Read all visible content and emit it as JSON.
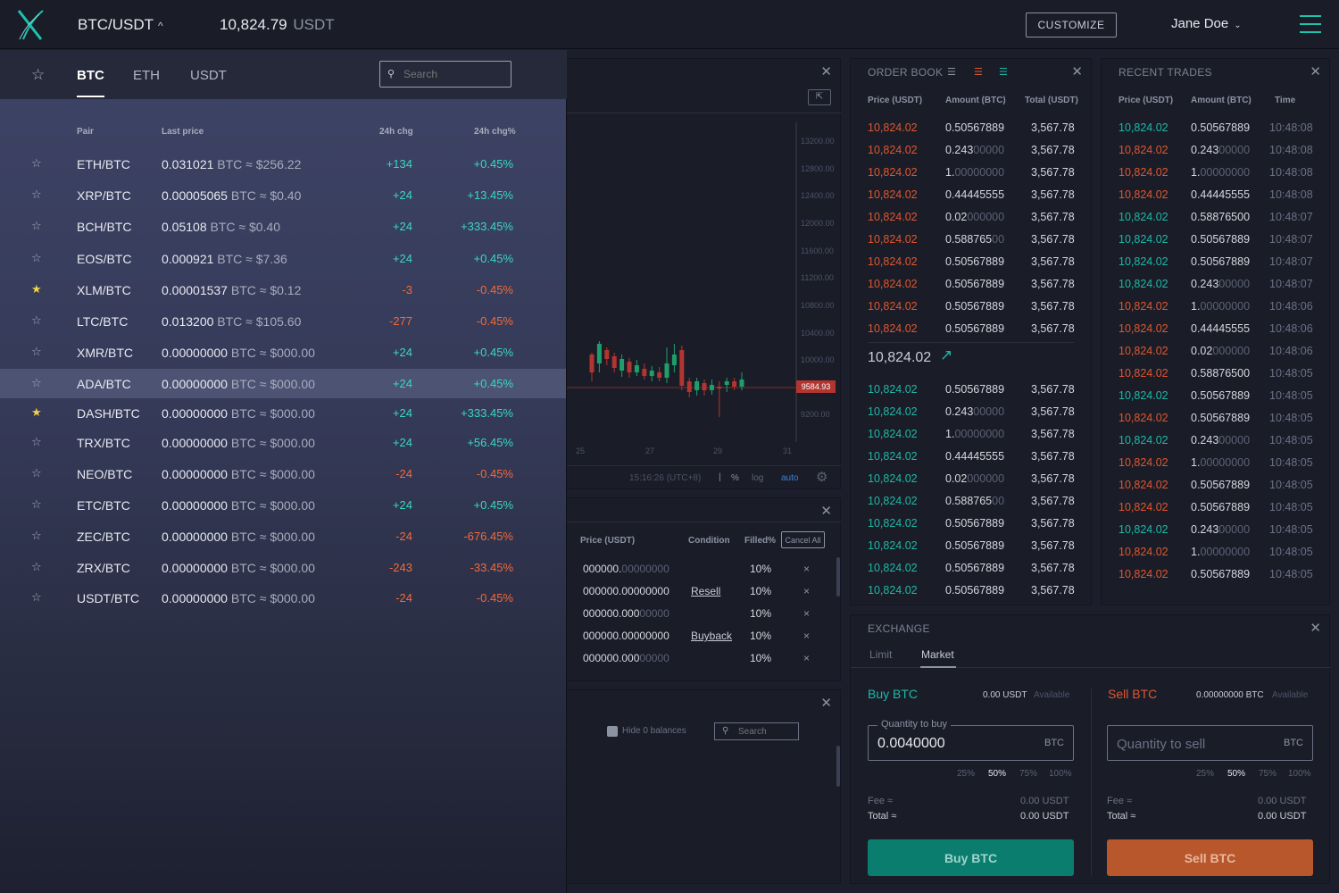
{
  "topbar": {
    "pair": "BTC/USDT",
    "price": "10,824.79",
    "price_unit": "USDT",
    "customize_label": "CUSTOMIZE",
    "user_name": "Jane Doe"
  },
  "market": {
    "tabs": [
      "BTC",
      "ETH",
      "USDT"
    ],
    "active_tab": "BTC",
    "search_placeholder": "Search",
    "headers": {
      "pair": "Pair",
      "last_price": "Last price",
      "chg": "24h chg",
      "chg_pct": "24h chg%"
    },
    "rows": [
      {
        "pair": "ETH/BTC",
        "price": "0.031021",
        "approx": "BTC ≈ $256.22",
        "chg": "+134",
        "pct": "+0.45%",
        "fav": false
      },
      {
        "pair": "XRP/BTC",
        "price": "0.00005065",
        "approx": "BTC ≈ $0.40",
        "chg": "+24",
        "pct": "+13.45%",
        "fav": false
      },
      {
        "pair": "BCH/BTC",
        "price": "0.05108",
        "approx": "BTC ≈ $0.40",
        "chg": "+24",
        "pct": "+333.45%",
        "fav": false
      },
      {
        "pair": "EOS/BTC",
        "price": "0.000921",
        "approx": "BTC ≈ $7.36",
        "chg": "+24",
        "pct": "+0.45%",
        "fav": false
      },
      {
        "pair": "XLM/BTC",
        "price": "0.00001537",
        "approx": "BTC ≈ $0.12",
        "chg": "-3",
        "pct": "-0.45%",
        "fav": true
      },
      {
        "pair": "LTC/BTC",
        "price": "0.013200",
        "approx": "BTC ≈ $105.60",
        "chg": "-277",
        "pct": "-0.45%",
        "fav": false
      },
      {
        "pair": "XMR/BTC",
        "price": "0.00000000",
        "approx": "BTC ≈ $000.00",
        "chg": "+24",
        "pct": "+0.45%",
        "fav": false
      },
      {
        "pair": "ADA/BTC",
        "price": "0.00000000",
        "approx": "BTC ≈ $000.00",
        "chg": "+24",
        "pct": "+0.45%",
        "fav": false,
        "selected": true
      },
      {
        "pair": "DASH/BTC",
        "price": "0.00000000",
        "approx": "BTC ≈ $000.00",
        "chg": "+24",
        "pct": "+333.45%",
        "fav": true
      },
      {
        "pair": "TRX/BTC",
        "price": "0.00000000",
        "approx": "BTC ≈ $000.00",
        "chg": "+24",
        "pct": "+56.45%",
        "fav": false
      },
      {
        "pair": "NEO/BTC",
        "price": "0.00000000",
        "approx": "BTC ≈ $000.00",
        "chg": "-24",
        "pct": "-0.45%",
        "fav": false
      },
      {
        "pair": "ETC/BTC",
        "price": "0.00000000",
        "approx": "BTC ≈ $000.00",
        "chg": "+24",
        "pct": "+0.45%",
        "fav": false
      },
      {
        "pair": "ZEC/BTC",
        "price": "0.00000000",
        "approx": "BTC ≈ $000.00",
        "chg": "-24",
        "pct": "-676.45%",
        "fav": false
      },
      {
        "pair": "ZRX/BTC",
        "price": "0.00000000",
        "approx": "BTC ≈ $000.00",
        "chg": "-243",
        "pct": "-33.45%",
        "fav": false
      },
      {
        "pair": "USDT/BTC",
        "price": "0.00000000",
        "approx": "BTC ≈ $000.00",
        "chg": "-24",
        "pct": "-0.45%",
        "fav": false
      }
    ]
  },
  "chart": {
    "price_axis": [
      "13200.00",
      "12800.00",
      "12400.00",
      "12000.00",
      "11600.00",
      "11200.00",
      "10800.00",
      "10400.00",
      "10000.00",
      "9584.93",
      "9200.00"
    ],
    "current_price_tag": "9584.93",
    "date_axis": [
      "25",
      "27",
      "29",
      "31"
    ],
    "time": "15:16:26 (UTC+8)",
    "options": [
      "%",
      "log",
      "auto"
    ]
  },
  "orders": {
    "headers": {
      "price": "Price (USDT)",
      "condition": "Condition",
      "filled": "Filled%"
    },
    "cancel_all": "Cancel All",
    "rows": [
      {
        "price": "000000.",
        "price_dim": "00000000",
        "condition": "",
        "filled": "10%"
      },
      {
        "price": "000000.00000000",
        "price_dim": "",
        "condition": "Resell",
        "filled": "10%"
      },
      {
        "price": "000000.000",
        "price_dim": "00000",
        "condition": "",
        "filled": "10%"
      },
      {
        "price": "000000.00000000",
        "price_dim": "",
        "condition": "Buyback",
        "filled": "10%"
      },
      {
        "price": "000000.000",
        "price_dim": "00000",
        "condition": "",
        "filled": "10%"
      }
    ]
  },
  "balances": {
    "hide_zero_label": "Hide 0 balances",
    "search_placeholder": "Search"
  },
  "order_book": {
    "title": "ORDER BOOK",
    "headers": {
      "price": "Price (USDT)",
      "amount": "Amount (BTC)",
      "total": "Total (USDT)"
    },
    "asks": [
      {
        "price": "10,824.02",
        "amt": "0.50567889",
        "dim": "",
        "total": "3,567.78"
      },
      {
        "price": "10,824.02",
        "amt": "0.243",
        "dim": "00000",
        "total": "3,567.78"
      },
      {
        "price": "10,824.02",
        "amt": "1.",
        "dim": "00000000",
        "total": "3,567.78"
      },
      {
        "price": "10,824.02",
        "amt": "0.44445555",
        "dim": "",
        "total": "3,567.78"
      },
      {
        "price": "10,824.02",
        "amt": "0.02",
        "dim": "000000",
        "total": "3,567.78"
      },
      {
        "price": "10,824.02",
        "amt": "0.588765",
        "dim": "00",
        "total": "3,567.78"
      },
      {
        "price": "10,824.02",
        "amt": "0.50567889",
        "dim": "",
        "total": "3,567.78"
      },
      {
        "price": "10,824.02",
        "amt": "0.50567889",
        "dim": "",
        "total": "3,567.78"
      },
      {
        "price": "10,824.02",
        "amt": "0.50567889",
        "dim": "",
        "total": "3,567.78"
      },
      {
        "price": "10,824.02",
        "amt": "0.50567889",
        "dim": "",
        "total": "3,567.78"
      }
    ],
    "last_price": "10,824.02",
    "bids": [
      {
        "price": "10,824.02",
        "amt": "0.50567889",
        "dim": "",
        "total": "3,567.78"
      },
      {
        "price": "10,824.02",
        "amt": "0.243",
        "dim": "00000",
        "total": "3,567.78"
      },
      {
        "price": "10,824.02",
        "amt": "1.",
        "dim": "00000000",
        "total": "3,567.78"
      },
      {
        "price": "10,824.02",
        "amt": "0.44445555",
        "dim": "",
        "total": "3,567.78"
      },
      {
        "price": "10,824.02",
        "amt": "0.02",
        "dim": "000000",
        "total": "3,567.78"
      },
      {
        "price": "10,824.02",
        "amt": "0.588765",
        "dim": "00",
        "total": "3,567.78"
      },
      {
        "price": "10,824.02",
        "amt": "0.50567889",
        "dim": "",
        "total": "3,567.78"
      },
      {
        "price": "10,824.02",
        "amt": "0.50567889",
        "dim": "",
        "total": "3,567.78"
      },
      {
        "price": "10,824.02",
        "amt": "0.50567889",
        "dim": "",
        "total": "3,567.78"
      },
      {
        "price": "10,824.02",
        "amt": "0.50567889",
        "dim": "",
        "total": "3,567.78"
      }
    ]
  },
  "recent_trades": {
    "title": "RECENT TRADES",
    "headers": {
      "price": "Price (USDT)",
      "amount": "Amount (BTC)",
      "time": "Time"
    },
    "rows": [
      {
        "price": "10,824.02",
        "side": "buy",
        "amt": "0.50567889",
        "dim": "",
        "time": "10:48:08"
      },
      {
        "price": "10,824.02",
        "side": "sell",
        "amt": "0.243",
        "dim": "00000",
        "time": "10:48:08"
      },
      {
        "price": "10,824.02",
        "side": "sell",
        "amt": "1.",
        "dim": "00000000",
        "time": "10:48:08"
      },
      {
        "price": "10,824.02",
        "side": "sell",
        "amt": "0.44445555",
        "dim": "",
        "time": "10:48:08"
      },
      {
        "price": "10,824.02",
        "side": "buy",
        "amt": "0.58876500",
        "dim": "",
        "time": "10:48:07"
      },
      {
        "price": "10,824.02",
        "side": "buy",
        "amt": "0.50567889",
        "dim": "",
        "time": "10:48:07"
      },
      {
        "price": "10,824.02",
        "side": "buy",
        "amt": "0.50567889",
        "dim": "",
        "time": "10:48:07"
      },
      {
        "price": "10,824.02",
        "side": "buy",
        "amt": "0.243",
        "dim": "00000",
        "time": "10:48:07"
      },
      {
        "price": "10,824.02",
        "side": "sell",
        "amt": "1.",
        "dim": "00000000",
        "time": "10:48:06"
      },
      {
        "price": "10,824.02",
        "side": "sell",
        "amt": "0.44445555",
        "dim": "",
        "time": "10:48:06"
      },
      {
        "price": "10,824.02",
        "side": "sell",
        "amt": "0.02",
        "dim": "000000",
        "time": "10:48:06"
      },
      {
        "price": "10,824.02",
        "side": "sell",
        "amt": "0.58876500",
        "dim": "",
        "time": "10:48:05"
      },
      {
        "price": "10,824.02",
        "side": "buy",
        "amt": "0.50567889",
        "dim": "",
        "time": "10:48:05"
      },
      {
        "price": "10,824.02",
        "side": "sell",
        "amt": "0.50567889",
        "dim": "",
        "time": "10:48:05"
      },
      {
        "price": "10,824.02",
        "side": "buy",
        "amt": "0.243",
        "dim": "00000",
        "time": "10:48:05"
      },
      {
        "price": "10,824.02",
        "side": "sell",
        "amt": "1.",
        "dim": "00000000",
        "time": "10:48:05"
      },
      {
        "price": "10,824.02",
        "side": "sell",
        "amt": "0.50567889",
        "dim": "",
        "time": "10:48:05"
      },
      {
        "price": "10,824.02",
        "side": "sell",
        "amt": "0.50567889",
        "dim": "",
        "time": "10:48:05"
      },
      {
        "price": "10,824.02",
        "side": "buy",
        "amt": "0.243",
        "dim": "00000",
        "time": "10:48:05"
      },
      {
        "price": "10,824.02",
        "side": "sell",
        "amt": "1.",
        "dim": "00000000",
        "time": "10:48:05"
      },
      {
        "price": "10,824.02",
        "side": "sell",
        "amt": "0.50567889",
        "dim": "",
        "time": "10:48:05"
      }
    ]
  },
  "exchange": {
    "title": "EXCHANGE",
    "tabs": [
      "Limit",
      "Market"
    ],
    "active_tab": "Market",
    "buy": {
      "title": "Buy BTC",
      "available": "0.00 USDT",
      "available_label": "Available",
      "qty_label": "Quantity to buy",
      "qty_value": "0.0040000",
      "unit": "BTC",
      "pcts": [
        "25%",
        "50%",
        "75%",
        "100%"
      ],
      "fee_label": "Fee ≈",
      "fee": "0.00 USDT",
      "total_label": "Total ≈",
      "total": "0.00 USDT",
      "button": "Buy BTC"
    },
    "sell": {
      "title": "Sell BTC",
      "available": "0.00000000 BTC",
      "available_label": "Available",
      "qty_placeholder": "Quantity to sell",
      "unit": "BTC",
      "pcts": [
        "25%",
        "50%",
        "75%",
        "100%"
      ],
      "fee_label": "Fee ≈",
      "fee": "0.00 USDT",
      "total_label": "Total ≈",
      "total": "0.00 USDT",
      "button": "Sell BTC"
    }
  },
  "colors": {
    "accent": "#1ec3b0",
    "buy": "#0b7d6f",
    "sell": "#b8572b",
    "up": "#3ad8c0",
    "down": "#f26a3a"
  }
}
